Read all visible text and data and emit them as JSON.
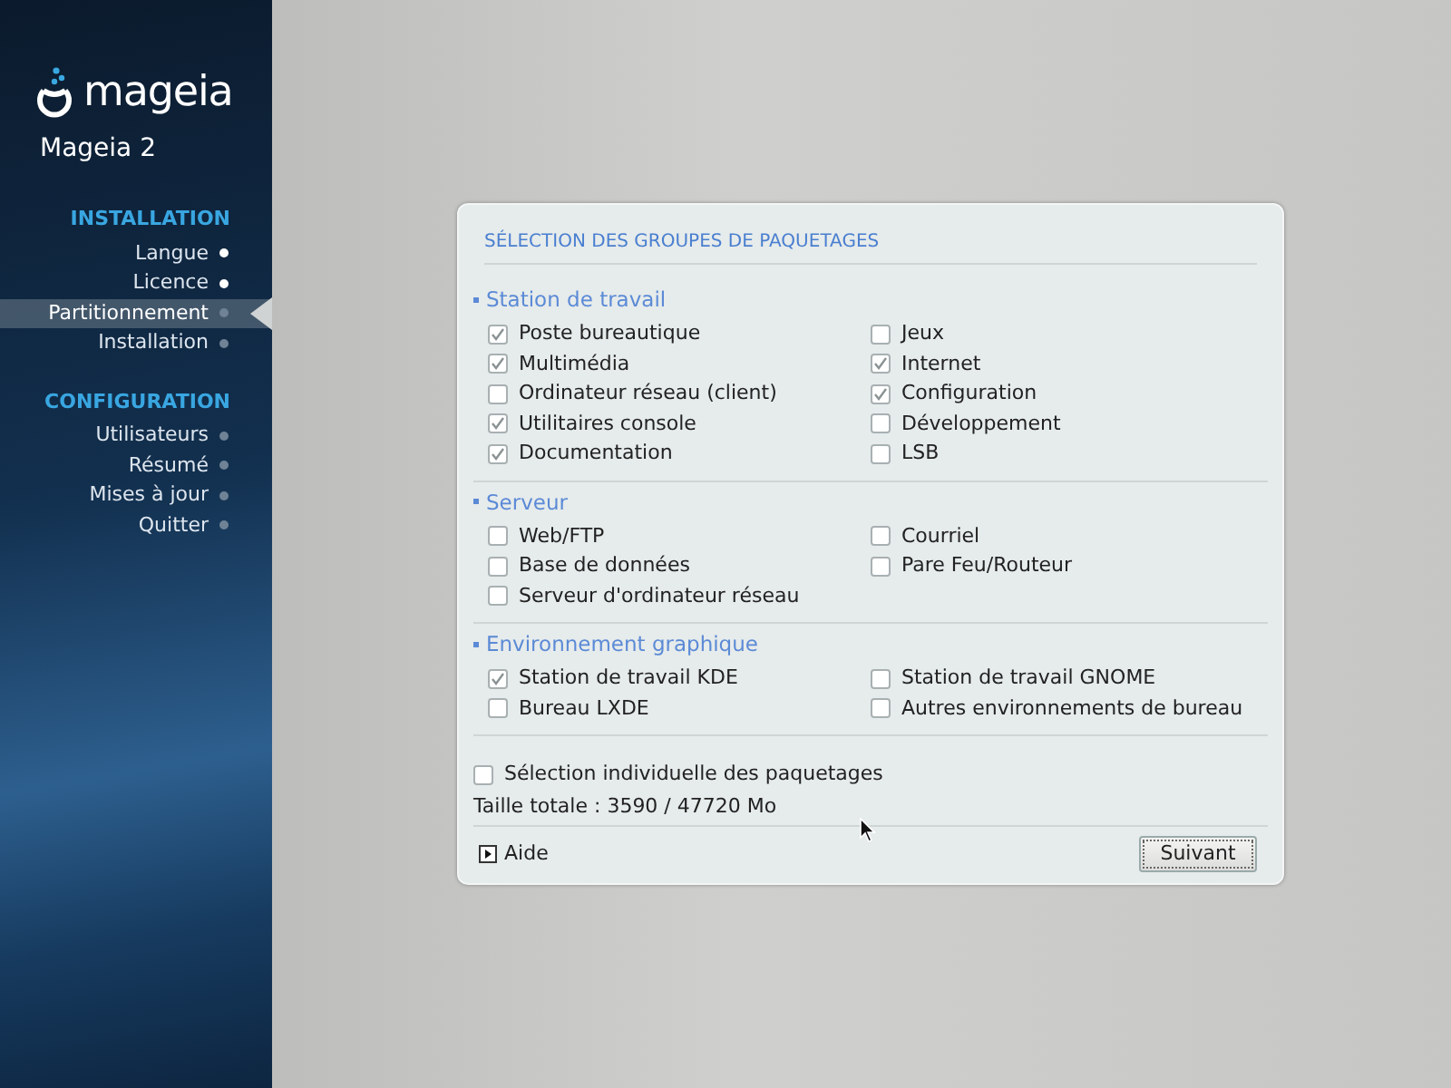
{
  "brand": {
    "logo": "mageia",
    "version": "Mageia 2"
  },
  "steps": [
    {
      "title": "INSTALLATION",
      "items": [
        {
          "label": "Langue",
          "done": true,
          "selected": false
        },
        {
          "label": "Licence",
          "done": true,
          "selected": false
        },
        {
          "label": "Partitionnement",
          "done": false,
          "selected": true
        },
        {
          "label": "Installation",
          "done": false,
          "selected": false
        }
      ]
    },
    {
      "title": "CONFIGURATION",
      "items": [
        {
          "label": "Utilisateurs",
          "done": false,
          "selected": false
        },
        {
          "label": "Résumé",
          "done": false,
          "selected": false
        },
        {
          "label": "Mises à jour",
          "done": false,
          "selected": false
        },
        {
          "label": "Quitter",
          "done": false,
          "selected": false
        }
      ]
    }
  ],
  "dialog": {
    "title": "SÉLECTION DES GROUPES DE PAQUETAGES",
    "groups": [
      {
        "title": "Station de travail",
        "items": [
          {
            "label": "Poste bureautique",
            "checked": true
          },
          {
            "label": "Jeux",
            "checked": false
          },
          {
            "label": "Multimédia",
            "checked": true
          },
          {
            "label": "Internet",
            "checked": true
          },
          {
            "label": "Ordinateur réseau (client)",
            "checked": false
          },
          {
            "label": "Configuration",
            "checked": true
          },
          {
            "label": "Utilitaires console",
            "checked": true
          },
          {
            "label": "Développement",
            "checked": false
          },
          {
            "label": "Documentation",
            "checked": true
          },
          {
            "label": "LSB",
            "checked": false
          }
        ]
      },
      {
        "title": "Serveur",
        "items": [
          {
            "label": "Web/FTP",
            "checked": false
          },
          {
            "label": "Courriel",
            "checked": false
          },
          {
            "label": "Base de données",
            "checked": false
          },
          {
            "label": "Pare Feu/Routeur",
            "checked": false
          },
          {
            "label": "Serveur d'ordinateur réseau",
            "checked": false
          }
        ]
      },
      {
        "title": "Environnement graphique",
        "items": [
          {
            "label": "Station de travail KDE",
            "checked": true
          },
          {
            "label": "Station de travail GNOME",
            "checked": false
          },
          {
            "label": "Bureau LXDE",
            "checked": false
          },
          {
            "label": "Autres environnements de bureau",
            "checked": false
          }
        ]
      }
    ],
    "individual": {
      "label": "Sélection individuelle des paquetages",
      "checked": false
    },
    "total": "Taille totale : 3590 / 47720 Mo",
    "help": "Aide",
    "next": "Suivant"
  }
}
